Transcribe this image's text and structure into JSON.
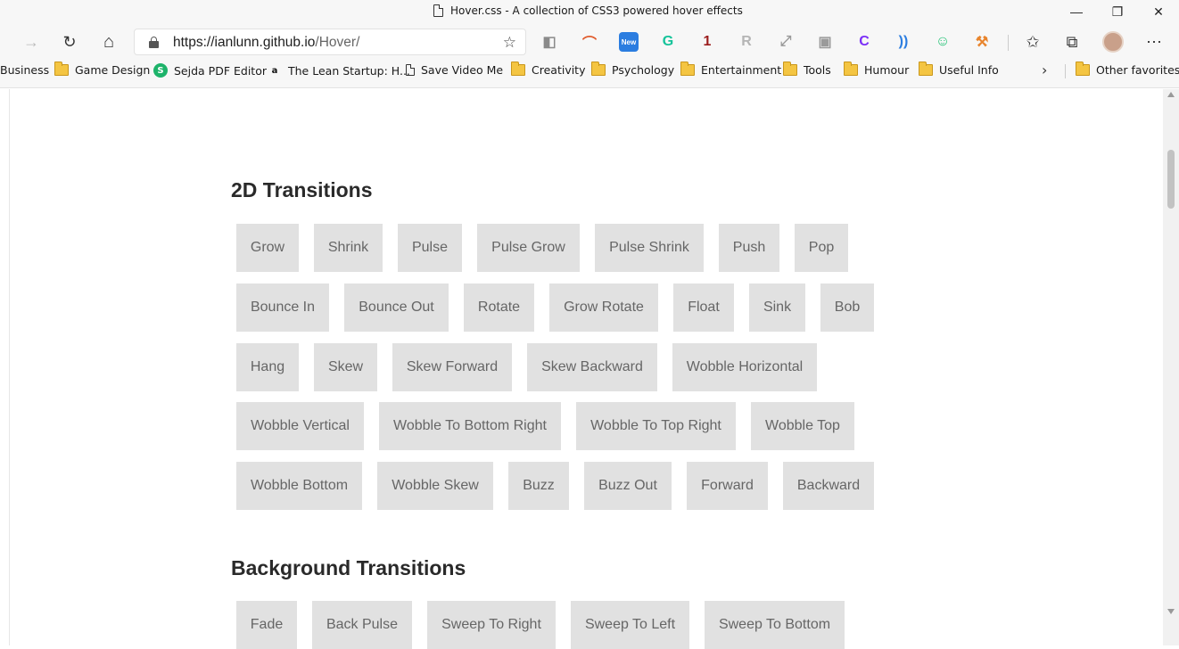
{
  "window": {
    "title": "Hover.css - A collection of CSS3 powered hover effects",
    "minimize": "—",
    "restore": "❐",
    "close": "✕"
  },
  "nav": {
    "back": "←",
    "forward": "→",
    "refresh": "↻",
    "home": "⌂",
    "url_host": "https://ianlunn.github.io",
    "url_path": "/Hover/",
    "add_favorite": "☆"
  },
  "extensions": [
    {
      "name": "office-ext",
      "glyph": "◧",
      "color": "#8a8a8a"
    },
    {
      "name": "rainbow-ext",
      "glyph": "⌒",
      "color": "#e05a2b"
    },
    {
      "name": "new-ext",
      "glyph": "New",
      "color": "#2b7de0"
    },
    {
      "name": "grammarly-ext",
      "glyph": "G",
      "color": "#15c39a"
    },
    {
      "name": "ublock-ext",
      "glyph": "1",
      "color": "#9b1c1c"
    },
    {
      "name": "gray-ext",
      "glyph": "R",
      "color": "#b5b5b5"
    },
    {
      "name": "fullscreen-ext",
      "glyph": "⤢",
      "color": "#9a9a9a"
    },
    {
      "name": "screenshot-ext",
      "glyph": "▣",
      "color": "#9a9a9a"
    },
    {
      "name": "purple-ext",
      "glyph": "C",
      "color": "#7b2ff7"
    },
    {
      "name": "read-aloud-ext",
      "glyph": "))",
      "color": "#2b7de0"
    },
    {
      "name": "green-ext",
      "glyph": "☺",
      "color": "#21c274"
    },
    {
      "name": "orange-ext",
      "glyph": "⚒",
      "color": "#e8842c"
    }
  ],
  "toolbar_right": {
    "favorites": "✩",
    "collections": "⧉",
    "menu": "⋯"
  },
  "favorites": [
    {
      "label": "Business",
      "icon": "none"
    },
    {
      "label": "Game Design",
      "icon": "folder"
    },
    {
      "label": "Sejda PDF Editor",
      "icon": "sejda",
      "icon_text": "S",
      "icon_color": "#1db36a"
    },
    {
      "label": "The Lean Startup: H...",
      "icon": "amazon",
      "icon_text": "a",
      "icon_color": "#111111"
    },
    {
      "label": "Save Video Me",
      "icon": "page"
    },
    {
      "label": "Creativity",
      "icon": "folder"
    },
    {
      "label": "Psychology",
      "icon": "folder"
    },
    {
      "label": "Entertainment",
      "icon": "folder"
    },
    {
      "label": "Tools",
      "icon": "folder"
    },
    {
      "label": "Humour",
      "icon": "folder"
    },
    {
      "label": "Useful Info",
      "icon": "folder"
    }
  ],
  "favorites_more": "›",
  "other_favorites": "Other favorites",
  "sections": [
    {
      "title": "2D Transitions",
      "rows": [
        [
          "Grow",
          "Shrink",
          "Pulse",
          "Pulse Grow",
          "Pulse Shrink",
          "Push",
          "Pop"
        ],
        [
          "Bounce In",
          "Bounce Out",
          "Rotate",
          "Grow Rotate",
          "Float",
          "Sink",
          "Bob"
        ],
        [
          "Hang",
          "Skew",
          "Skew Forward",
          "Skew Backward",
          "Wobble Horizontal"
        ],
        [
          "Wobble Vertical",
          "Wobble To Bottom Right",
          "Wobble To Top Right",
          "Wobble Top"
        ],
        [
          "Wobble Bottom",
          "Wobble Skew",
          "Buzz",
          "Buzz Out",
          "Forward",
          "Backward"
        ]
      ]
    },
    {
      "title": "Background Transitions",
      "rows": [
        [
          "Fade",
          "Back Pulse",
          "Sweep To Right",
          "Sweep To Left",
          "Sweep To Bottom"
        ]
      ]
    }
  ]
}
